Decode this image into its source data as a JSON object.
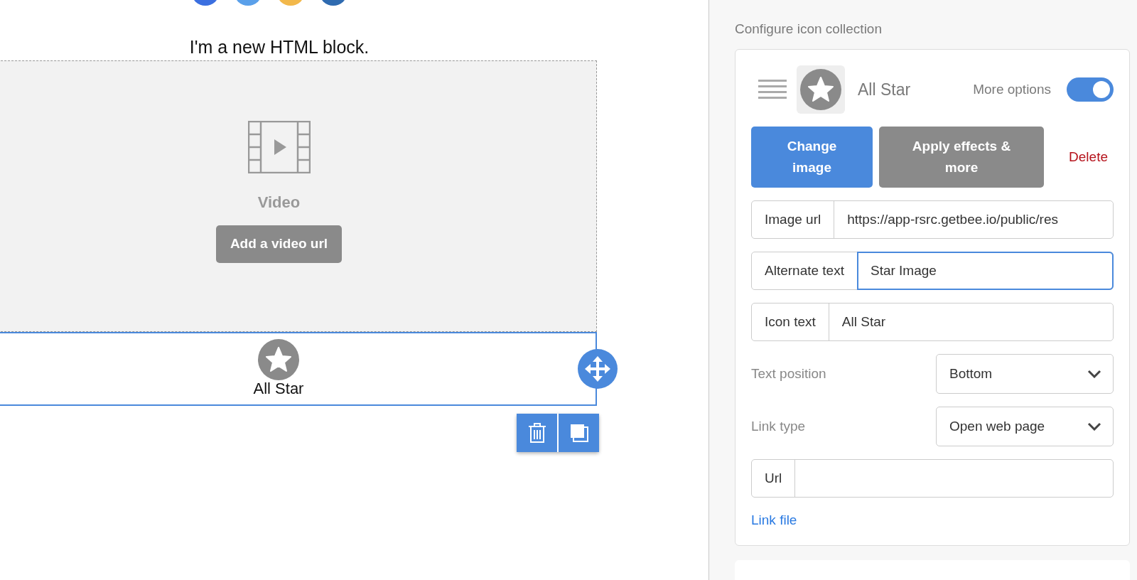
{
  "social_icons": [
    {
      "color": "#3b6fe0"
    },
    {
      "color": "#5aa0ea"
    },
    {
      "color": "#f2b84b"
    },
    {
      "color": "#2f6bb0"
    }
  ],
  "html_block": {
    "text": "I'm a new HTML block."
  },
  "video_block": {
    "title": "Video",
    "button": "Add a video url"
  },
  "icon_block": {
    "label": "All Star",
    "selected": true
  },
  "panel": {
    "title": "Configure icon collection",
    "item": {
      "name": "All Star",
      "more_options_label": "More options",
      "more_options_on": true,
      "buttons": [
        {
          "label": "Change image",
          "kind": "primary"
        },
        {
          "label": "Apply effects & more",
          "kind": "secondary"
        },
        {
          "label": "Delete",
          "kind": "danger"
        }
      ],
      "fields": [
        {
          "label": "Image url",
          "value": "https://app-rsrc.getbee.io/public/res",
          "focused": false
        },
        {
          "label": "Alternate text",
          "value": "Star Image",
          "focused": true
        },
        {
          "label": "Icon text",
          "value": "All Star",
          "focused": false
        }
      ],
      "selects": [
        {
          "label": "Text position",
          "value": "Bottom"
        },
        {
          "label": "Link type",
          "value": "Open web page"
        }
      ],
      "url_field": {
        "label": "Url"
      },
      "link": "Link file"
    }
  }
}
